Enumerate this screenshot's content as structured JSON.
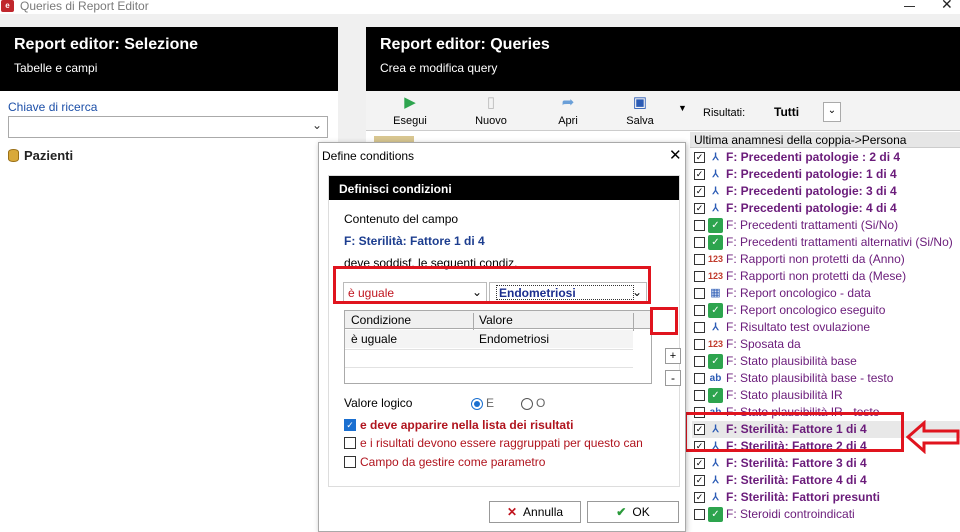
{
  "window": {
    "title": "Queries di Report Editor",
    "icon": "app-icon"
  },
  "left_panel": {
    "title": "Report editor: Selezione",
    "subtitle": "Tabelle e campi",
    "search_label": "Chiave di ricerca",
    "search_value": "",
    "tree_root": "Pazienti"
  },
  "right_panel": {
    "title": "Report editor: Queries",
    "subtitle": "Crea e modifica query",
    "toolbar": [
      {
        "label": "Esegui",
        "icon": "play-icon"
      },
      {
        "label": "Nuovo",
        "icon": "new-document-icon"
      },
      {
        "label": "Apri",
        "icon": "open-folder-icon"
      },
      {
        "label": "Salva",
        "icon": "save-icon"
      }
    ],
    "results_label": "Risultati:",
    "results_value": "Tutti"
  },
  "field_list": {
    "header": "Ultima anamnesi della coppia->Persona",
    "items": [
      {
        "text": "F: Precedenti patologie : 2 di 4",
        "checked": true,
        "icon": "tree",
        "bold": true
      },
      {
        "text": "F: Precedenti patologie: 1 di 4",
        "checked": true,
        "icon": "tree",
        "bold": true
      },
      {
        "text": "F: Precedenti patologie: 3 di 4",
        "checked": true,
        "icon": "tree",
        "bold": true
      },
      {
        "text": "F: Precedenti patologie: 4 di 4",
        "checked": true,
        "icon": "tree",
        "bold": true
      },
      {
        "text": "F: Precedenti trattamenti (Si/No)",
        "checked": false,
        "icon": "check",
        "bold": false
      },
      {
        "text": "F: Precedenti trattamenti alternativi (Si/No)",
        "checked": false,
        "icon": "check",
        "bold": false
      },
      {
        "text": "F: Rapporti non protetti da (Anno)",
        "checked": false,
        "icon": "num",
        "bold": false
      },
      {
        "text": "F: Rapporti non protetti da (Mese)",
        "checked": false,
        "icon": "num",
        "bold": false
      },
      {
        "text": "F: Report oncologico - data",
        "checked": false,
        "icon": "cal",
        "bold": false
      },
      {
        "text": "F: Report oncologico eseguito",
        "checked": false,
        "icon": "check",
        "bold": false
      },
      {
        "text": "F: Risultato test ovulazione",
        "checked": false,
        "icon": "tree",
        "bold": false
      },
      {
        "text": "F: Sposata da",
        "checked": false,
        "icon": "num",
        "bold": false
      },
      {
        "text": "F: Stato plausibilità base",
        "checked": false,
        "icon": "check",
        "bold": false
      },
      {
        "text": "F: Stato plausibilità base - testo",
        "checked": false,
        "icon": "txt",
        "bold": false
      },
      {
        "text": "F: Stato plausibilità IR",
        "checked": false,
        "icon": "check",
        "bold": false
      },
      {
        "text": "F: Stato plausibilità IR - testo",
        "checked": false,
        "icon": "txt",
        "bold": false
      },
      {
        "text": "F: Sterilità: Fattore 1 di 4",
        "checked": true,
        "icon": "tree",
        "bold": true
      },
      {
        "text": "F: Sterilità: Fattore 2 di 4",
        "checked": true,
        "icon": "tree",
        "bold": true
      },
      {
        "text": "F: Sterilità: Fattore 3 di 4",
        "checked": true,
        "icon": "tree",
        "bold": true
      },
      {
        "text": "F: Sterilità: Fattore 4 di 4",
        "checked": true,
        "icon": "tree",
        "bold": true
      },
      {
        "text": "F: Sterilità: Fattori presunti",
        "checked": true,
        "icon": "tree",
        "bold": true
      },
      {
        "text": "F: Steroidi controindicati",
        "checked": false,
        "icon": "check",
        "bold": false
      }
    ]
  },
  "dialog": {
    "title": "Define conditions",
    "header": "Definisci condizioni",
    "field_label": "Contenuto del campo",
    "field_name": "F: Sterilità: Fattore 1 di 4",
    "condition_label": "deve soddisf. le seguenti condiz.",
    "condition_value": "è uguale",
    "value_value": "Endometriosi",
    "table": {
      "columns": [
        "Condizione",
        "Valore"
      ],
      "rows": [
        [
          "è uguale",
          "Endometriosi"
        ]
      ]
    },
    "add_label": "+",
    "remove_label": "-",
    "logic_label": "Valore logico",
    "logic_and": "E",
    "logic_or": "O",
    "options": [
      {
        "label": "e deve apparire nella lista dei risultati",
        "checked": true
      },
      {
        "label": "e i risultati devono essere raggruppati per questo can",
        "checked": false
      },
      {
        "label": "Campo da gestire come parametro",
        "checked": false
      }
    ],
    "cancel_label": "Annulla",
    "ok_label": "OK"
  },
  "colors": {
    "highlight": "#e0141e",
    "header": "#000000",
    "field_text": "#6a1b7a"
  }
}
